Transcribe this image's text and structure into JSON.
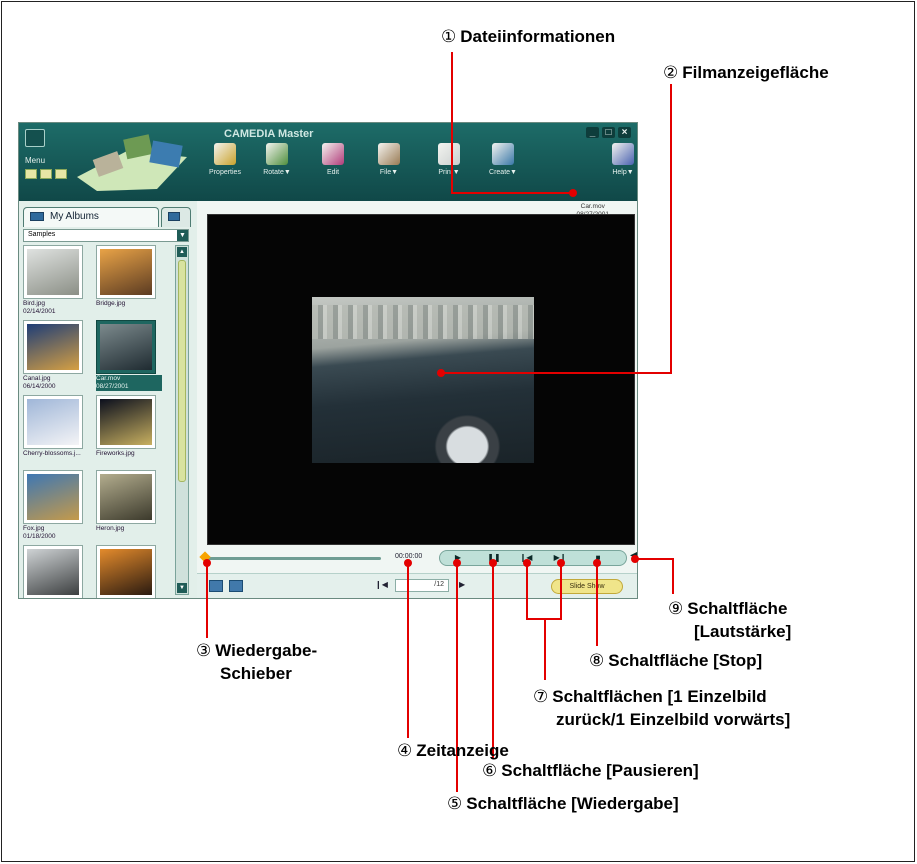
{
  "app": {
    "title": "CAMEDIA Master",
    "menu_label": "Menu",
    "window_buttons": [
      "_",
      "□",
      "×"
    ],
    "toolbar": [
      {
        "label": "Properties",
        "icon": "properties-icon",
        "color": "#c9a22c"
      },
      {
        "label": "Rotate▼",
        "icon": "rotate-icon",
        "color": "#4f8f3d"
      },
      {
        "label": "Edit",
        "icon": "edit-icon",
        "color": "#b13c7a"
      },
      {
        "label": "File▼",
        "icon": "file-icon",
        "color": "#9a7b54"
      },
      {
        "label": "Print▼",
        "icon": "print-icon",
        "color": "#c9cfcf"
      },
      {
        "label": "Create▼",
        "icon": "create-icon",
        "color": "#3a78a8"
      },
      {
        "label": "Help▼",
        "icon": "help-icon",
        "color": "#4a62b0"
      }
    ]
  },
  "left_panel": {
    "tab_label": "My Albums",
    "dropdown_value": "Samples",
    "thumbnails": [
      {
        "name": "Bird.jpg",
        "date": "02/14/2001",
        "colors": [
          "#dfe2e0",
          "#8b8f86"
        ]
      },
      {
        "name": "Bridge.jpg",
        "date": "",
        "colors": [
          "#e9a347",
          "#5b3b22"
        ]
      },
      {
        "name": "Canal.jpg",
        "date": "06/14/2000",
        "colors": [
          "#1e3d77",
          "#d6a043"
        ]
      },
      {
        "name": "Car.mov",
        "date": "08/27/2001",
        "colors": [
          "#7c8a8d",
          "#1f2b31"
        ],
        "selected": true
      },
      {
        "name": "Cherry-blossoms.j...",
        "date": "",
        "colors": [
          "#9fb6d8",
          "#f4f4f6"
        ]
      },
      {
        "name": "Fireworks.jpg",
        "date": "",
        "colors": [
          "#0b0f1d",
          "#c8b060"
        ]
      },
      {
        "name": "Fox.jpg",
        "date": "01/18/2000",
        "colors": [
          "#3e77b3",
          "#c59a4a"
        ]
      },
      {
        "name": "Heron.jpg",
        "date": "",
        "colors": [
          "#b3ad8e",
          "#3c3a2c"
        ]
      },
      {
        "name": "",
        "date": "",
        "colors": [
          "#cfd3d5",
          "#3c3f40"
        ]
      },
      {
        "name": "",
        "date": "",
        "colors": [
          "#e48b2c",
          "#2a1a10"
        ]
      }
    ]
  },
  "viewer": {
    "file_name": "Car.mov",
    "file_date": "08/27/2001",
    "timecode": "00:00:00",
    "page_total": "/12",
    "slideshow_label": "Slide Show",
    "playback_position": 0
  },
  "callouts": [
    {
      "num": "①",
      "text": "Dateiinformationen"
    },
    {
      "num": "②",
      "text": "Filmanzeigefläche"
    },
    {
      "num": "③",
      "text": "Wiedergabe-",
      "text2": "Schieber"
    },
    {
      "num": "④",
      "text": "Zeitanzeige"
    },
    {
      "num": "⑤",
      "text": "Schaltfläche [Wiedergabe]"
    },
    {
      "num": "⑥",
      "text": "Schaltfläche [Pausieren]"
    },
    {
      "num": "⑦",
      "text": "Schaltflächen [1 Einzelbild",
      "text2": "zurück/1 Einzelbild vorwärts]"
    },
    {
      "num": "⑧",
      "text": "Schaltfläche [Stop]"
    },
    {
      "num": "⑨",
      "text": "Schaltfläche",
      "text2": "[Lautstärke]"
    }
  ]
}
